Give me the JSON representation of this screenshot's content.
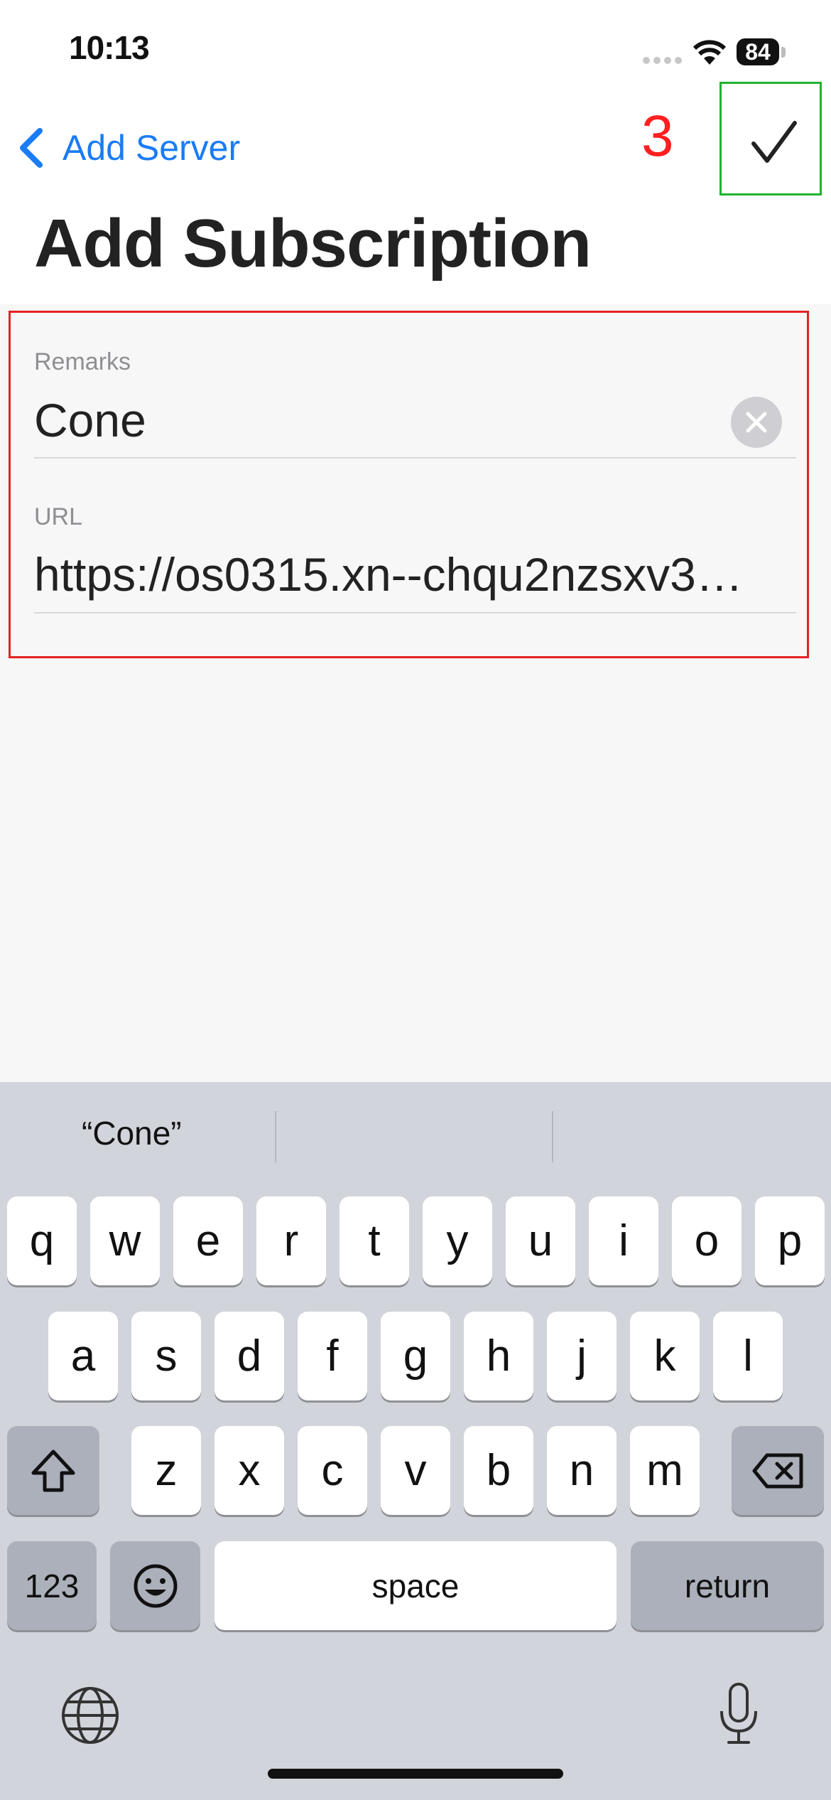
{
  "status_bar": {
    "time": "10:13",
    "battery": "84"
  },
  "nav": {
    "back_label": "Add Server",
    "step_number": "3",
    "confirm_icon": "checkmark-icon"
  },
  "page": {
    "title": "Add Subscription"
  },
  "form": {
    "remarks": {
      "label": "Remarks",
      "value": "Cone"
    },
    "url": {
      "label": "URL",
      "value": "https://os0315.xn--chqu2nzsxv3…"
    }
  },
  "keyboard": {
    "suggestions": [
      "“Cone”",
      "",
      ""
    ],
    "row1": [
      "q",
      "w",
      "e",
      "r",
      "t",
      "y",
      "u",
      "i",
      "o",
      "p"
    ],
    "row2": [
      "a",
      "s",
      "d",
      "f",
      "g",
      "h",
      "j",
      "k",
      "l"
    ],
    "row3": [
      "z",
      "x",
      "c",
      "v",
      "b",
      "n",
      "m"
    ],
    "numbers_label": "123",
    "space_label": "space",
    "return_label": "return"
  },
  "colors": {
    "accent": "#1a7cf5",
    "annotation_red": "#ff1f1f",
    "annotation_green": "#22b230"
  }
}
